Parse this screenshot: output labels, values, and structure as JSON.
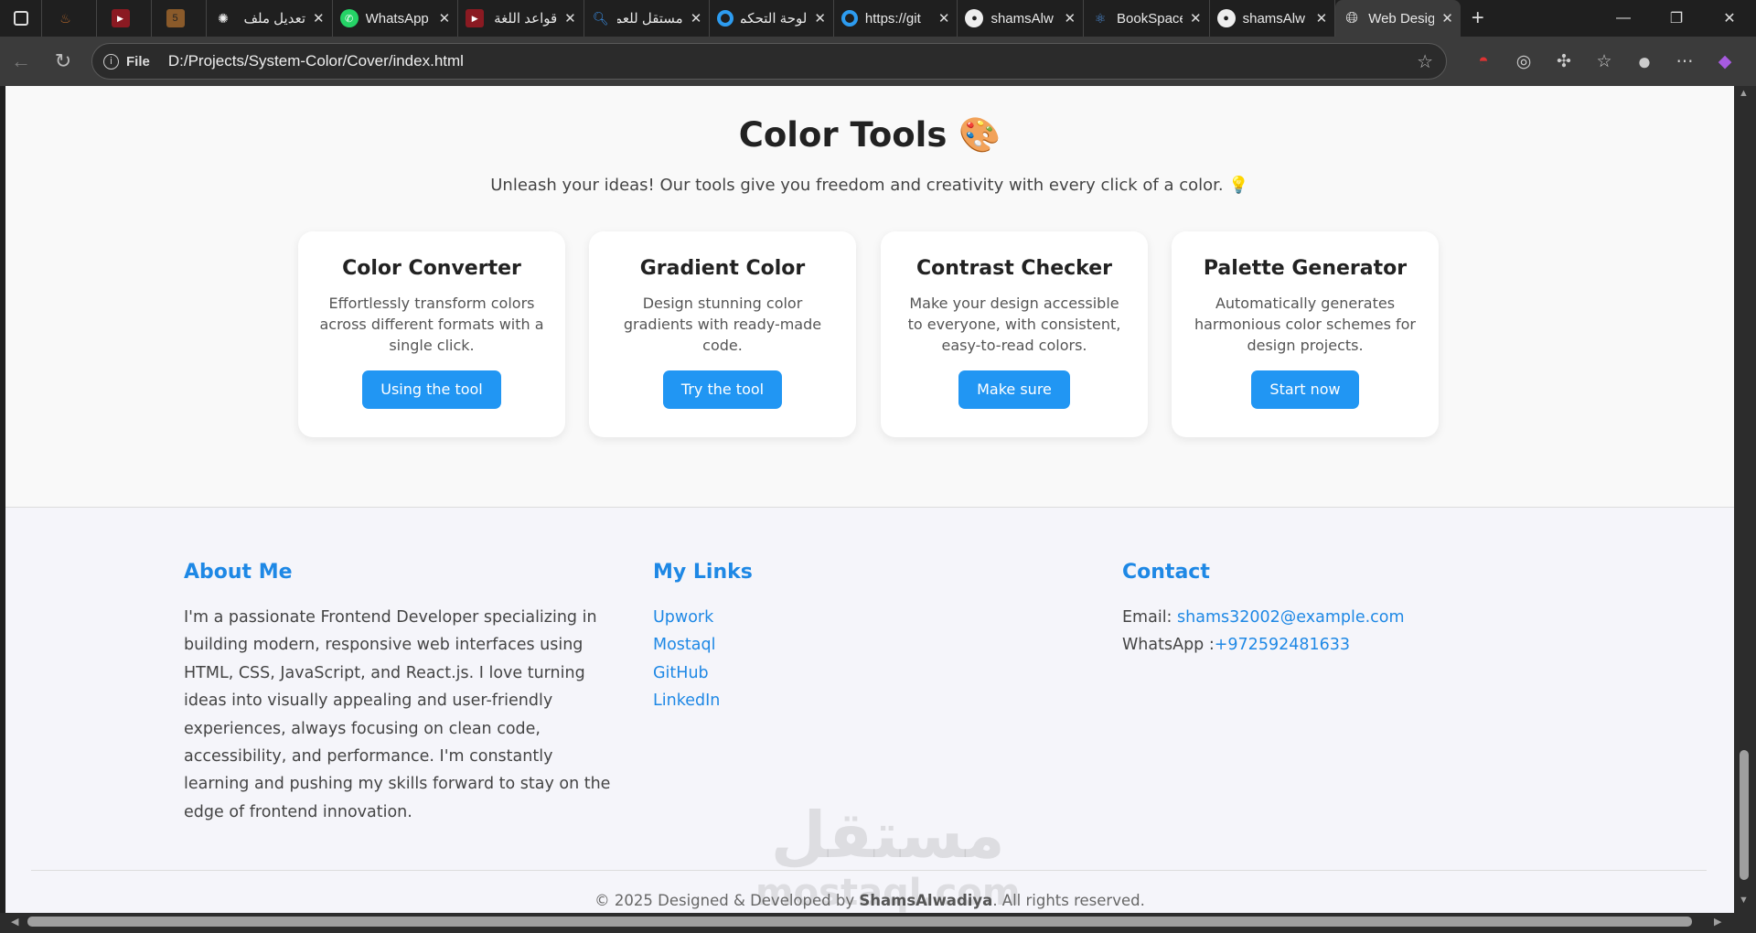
{
  "browser": {
    "tabs": [
      {
        "label": "",
        "icon": "flame-icon"
      },
      {
        "label": "",
        "icon": "youtube-icon"
      },
      {
        "label": "",
        "icon": "html5-icon"
      },
      {
        "label": "تعديل ملف",
        "icon": "chatgpt-icon"
      },
      {
        "label": "WhatsApp",
        "icon": "whatsapp-icon"
      },
      {
        "label": "قواعد اللغة",
        "icon": "youtube-icon"
      },
      {
        "label": "مستقل للعمل",
        "icon": "search-icon"
      },
      {
        "label": "لوحة التحكم",
        "icon": "circle-icon"
      },
      {
        "label": "https://git",
        "icon": "circle-icon"
      },
      {
        "label": "shamsAlw",
        "icon": "github-icon"
      },
      {
        "label": "BookSpace",
        "icon": "react-icon"
      },
      {
        "label": "shamsAlw",
        "icon": "github-icon"
      },
      {
        "label": "Web Design",
        "icon": "globe-icon"
      }
    ],
    "address_prefix": "File",
    "url": "D:/Projects/System-Color/Cover/index.html"
  },
  "hero": {
    "title": "Color Tools 🎨",
    "subtitle": "Unleash your ideas! Our tools give you freedom and creativity with every click of a color. 💡"
  },
  "cards": [
    {
      "title": "Color Converter",
      "desc": "Effortlessly transform colors across different formats with a single click.",
      "button": "Using the tool"
    },
    {
      "title": "Gradient Color",
      "desc": "Design stunning color gradients with ready-made code.",
      "button": "Try the tool"
    },
    {
      "title": "Contrast Checker",
      "desc": "Make your design accessible to everyone, with consistent, easy-to-read colors.",
      "button": "Make sure"
    },
    {
      "title": "Palette Generator",
      "desc": "Automatically generates harmonious color schemes for design projects.",
      "button": "Start now"
    }
  ],
  "footer": {
    "about": {
      "heading": "About Me",
      "text": "I'm a passionate Frontend Developer specializing in building modern, responsive web interfaces using HTML, CSS, JavaScript, and React.js. I love turning ideas into visually appealing and user-friendly experiences, always focusing on clean code, accessibility, and performance. I'm constantly learning and pushing my skills forward to stay on the edge of frontend innovation."
    },
    "links": {
      "heading": "My Links",
      "items": [
        "Upwork",
        "Mostaql",
        "GitHub",
        "LinkedIn"
      ]
    },
    "contact": {
      "heading": "Contact",
      "email_label": "Email: ",
      "email": "shams32002@example.com",
      "whatsapp_label": "WhatsApp :",
      "whatsapp": "+972592481633"
    },
    "copyright_pre": "© 2025 Designed & Developed by ",
    "copyright_name": "ShamsAlwadiya",
    "copyright_post": ". All rights reserved."
  },
  "watermark": {
    "arabic": "مستقل",
    "latin": "mostaql.com"
  }
}
